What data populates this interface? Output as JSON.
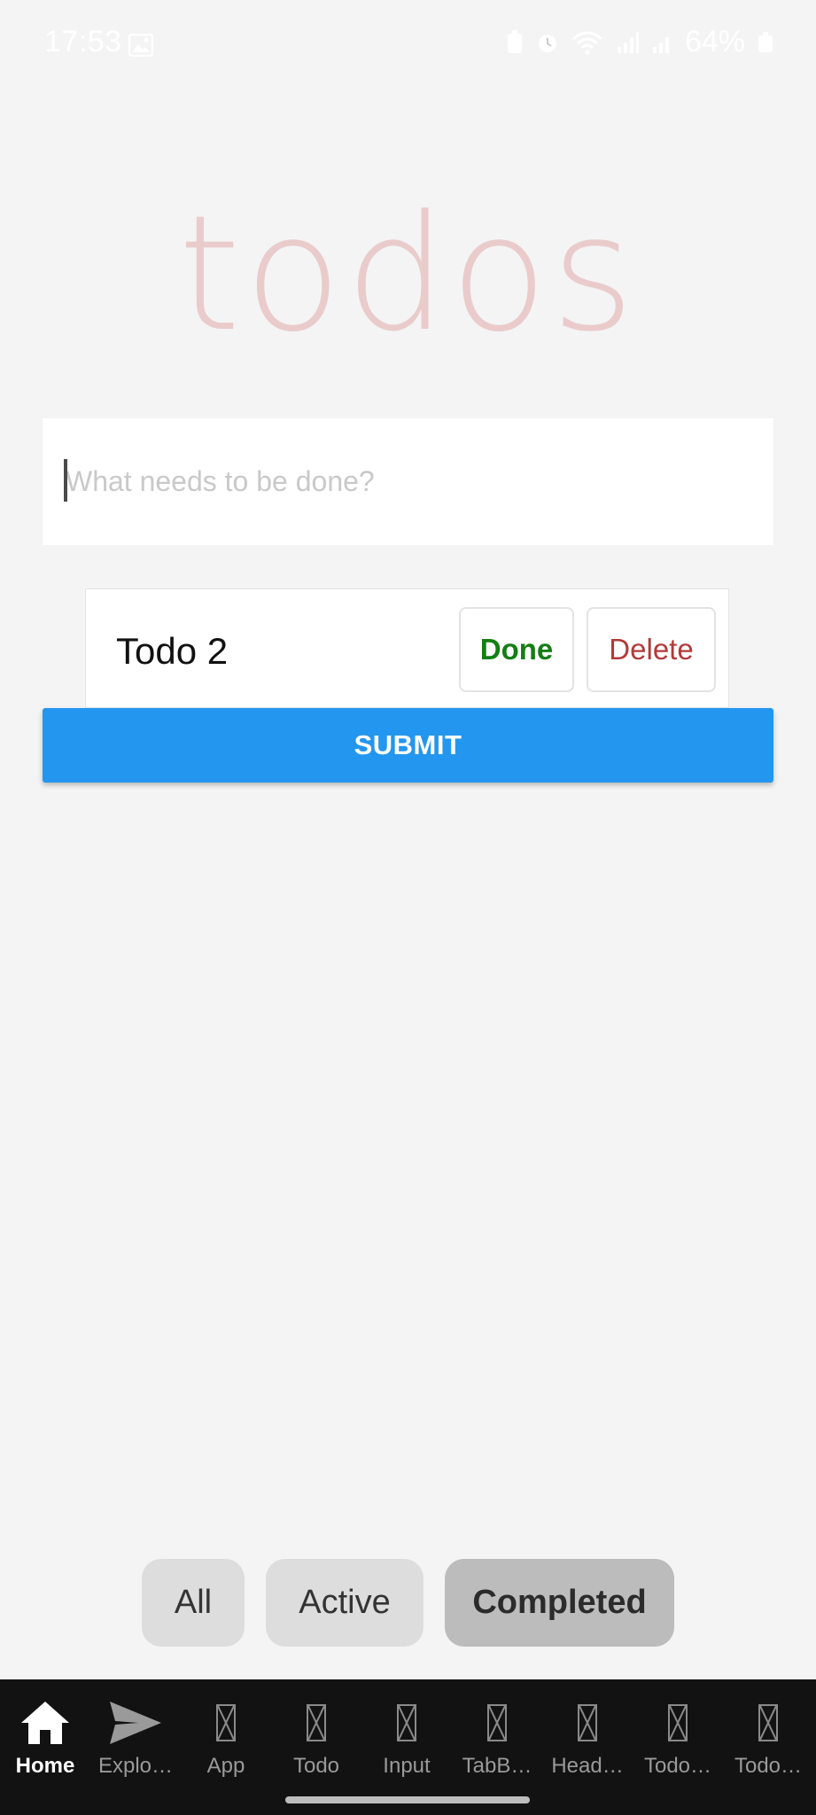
{
  "status_bar": {
    "time": "17:53",
    "battery": "64%"
  },
  "app": {
    "title": "todos"
  },
  "input": {
    "placeholder": "What needs to be done?",
    "value": ""
  },
  "todos": [
    {
      "text": "Todo 2",
      "done_label": "Done",
      "delete_label": "Delete"
    }
  ],
  "submit_label": "SUBMIT",
  "filters": {
    "all": "All",
    "active": "Active",
    "completed": "Completed",
    "selected": "completed"
  },
  "bottom_nav": {
    "items": [
      {
        "label": "Home",
        "icon": "home-icon"
      },
      {
        "label": "Explo…",
        "icon": "send-icon"
      },
      {
        "label": "App",
        "icon": "missing-glyph-icon"
      },
      {
        "label": "Todo",
        "icon": "missing-glyph-icon"
      },
      {
        "label": "Input",
        "icon": "missing-glyph-icon"
      },
      {
        "label": "TabB…",
        "icon": "missing-glyph-icon"
      },
      {
        "label": "Head…",
        "icon": "missing-glyph-icon"
      },
      {
        "label": "Todo…",
        "icon": "missing-glyph-icon"
      },
      {
        "label": "Todo…",
        "icon": "missing-glyph-icon"
      }
    ],
    "active_index": 0
  },
  "colors": {
    "background": "#f4f4f4",
    "title": "#eacbcb",
    "submit": "#2396f0",
    "done": "#137e13",
    "delete": "#b23a3a",
    "nav_bg": "#121212"
  }
}
